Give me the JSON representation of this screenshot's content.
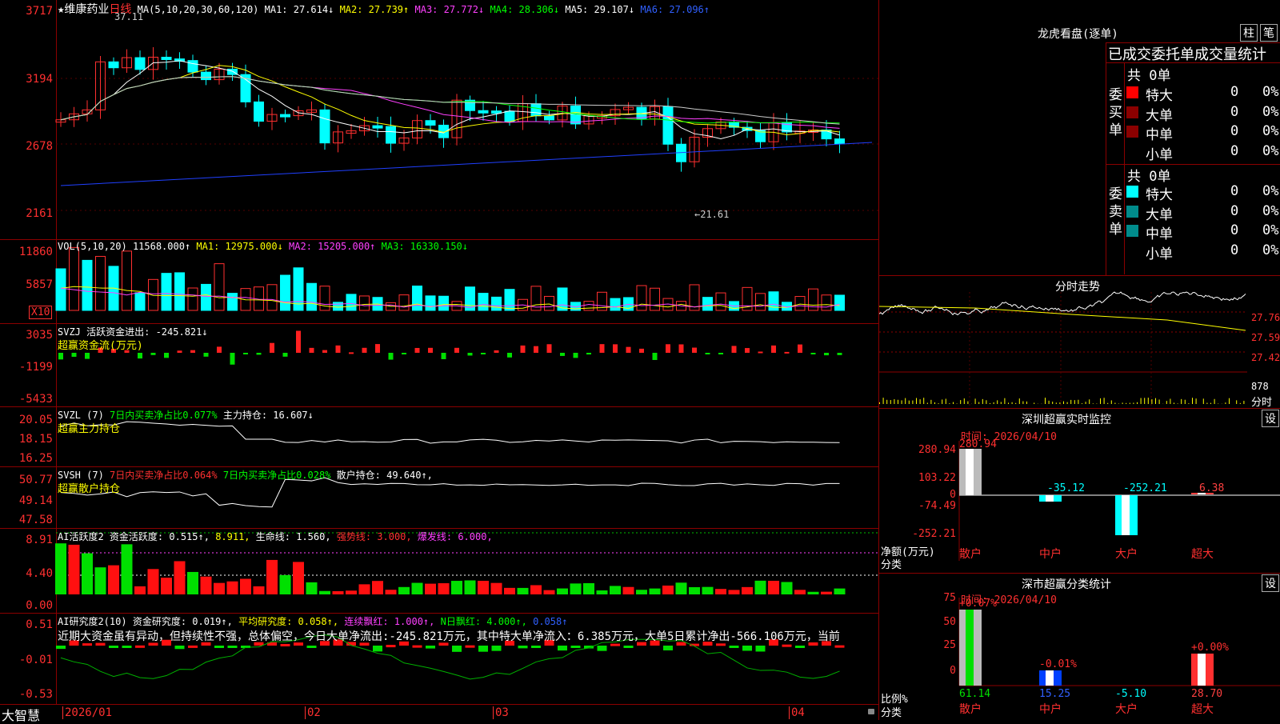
{
  "stock": {
    "name": "★维康药业",
    "period": "日线"
  },
  "price_header": {
    "ma_params": "MA(5,10,20,30,60,120)",
    "ma1": "MA1: 27.614↓",
    "ma2": "MA2: 27.739↑",
    "ma3": "MA3: 27.772↓",
    "ma4": "MA4: 28.306↓",
    "ma5": "MA5: 29.107↓",
    "ma6": "MA6: 27.096↑"
  },
  "price_axis": [
    "3717",
    "3194",
    "2678",
    "2161"
  ],
  "price_marks": {
    "high": "37.11",
    "low": "←21.61"
  },
  "vol_header": {
    "name": "VOL(5,10,20)",
    "val": "11568.000↑",
    "ma1": "MA1: 12975.000↓",
    "ma2": "MA2: 15205.000↑",
    "ma3": "MA3: 16330.150↓"
  },
  "vol_axis": [
    "11860",
    "5857"
  ],
  "vol_unit": "X10",
  "svzj": {
    "header": "SVZJ  活跃资金进出: -245.821↓",
    "sub": "超赢资金流(万元)",
    "axis": [
      "3035",
      "-1199",
      "-5433"
    ]
  },
  "svzl": {
    "name": "SVZL (7)",
    "ratio": "7日内买卖净占比0.077%",
    "hold": "主力持仓: 16.607↓",
    "sub": "超赢主力持仓",
    "axis": [
      "20.05",
      "18.15",
      "16.25"
    ]
  },
  "svsh": {
    "name": "SVSH (7)",
    "ratio1": "7日内买卖净占比0.064%",
    "ratio2": "7日内买卖净占比0.028%",
    "hold": "散户持仓: 49.640↑,",
    "sub": "超赢散户持仓",
    "axis": [
      "50.77",
      "49.14",
      "47.58"
    ]
  },
  "ai1": {
    "name": "AI活跃度2",
    "a": "资金活跃度: 0.515↑,",
    "b": "8.911,",
    "c": "生命线: 1.560,",
    "d": "强势线: 3.000,",
    "e": "爆发线: 6.000,",
    "axis": [
      "8.91",
      "4.40",
      "0.00"
    ]
  },
  "ai2": {
    "name": "AI研究度2(10)",
    "a": "资金研究度: 0.019↑,",
    "b": "平均研究度: 0.058↑,",
    "c": "连续飘红: 1.000↑,",
    "d": "N日飘红: 4.000↑,",
    "e": "0.058↑",
    "axis": [
      "0.51",
      "-0.01",
      "-0.53"
    ],
    "comment": "近期大资金虽有异动，但持续性不强，总体偏空，今日大单净流出:-245.821万元，其中特大单净流入：6.385万元，大单5日累计净出-566.106万元，当前"
  },
  "date_axis": {
    "brand": "大智慧",
    "labels": [
      "2026/01",
      "02",
      "03",
      "04"
    ]
  },
  "lhb": {
    "title": "龙虎看盘(逐单)",
    "btn1": "柱",
    "btn2": "笔",
    "sub": "已成交委托单成交量统计",
    "buy_label": "委买单",
    "sell_label": "委卖单",
    "buy_total": "共 0单",
    "sell_total": "共 0单",
    "buy_rows": [
      {
        "name": "特大",
        "num": "0",
        "pct": "0%",
        "color": "#ff0000"
      },
      {
        "name": "大单",
        "num": "0",
        "pct": "0%",
        "color": "#8b0000"
      },
      {
        "name": "中单",
        "num": "0",
        "pct": "0%",
        "color": "#8b0000"
      },
      {
        "name": "小单",
        "num": "0",
        "pct": "0%",
        "color": "#000000"
      }
    ],
    "sell_rows": [
      {
        "name": "特大",
        "num": "0",
        "pct": "0%",
        "color": "#00ffff"
      },
      {
        "name": "大单",
        "num": "0",
        "pct": "0%",
        "color": "#008b8b"
      },
      {
        "name": "中单",
        "num": "0",
        "pct": "0%",
        "color": "#008b8b"
      },
      {
        "name": "小单",
        "num": "0",
        "pct": "0%",
        "color": "#000000"
      }
    ]
  },
  "fenshi": {
    "title": "分时走势",
    "axis": [
      "27.76",
      "27.59",
      "27.42"
    ],
    "vol": "878",
    "vol_label": "分时"
  },
  "monitor": {
    "title": "深圳超赢实时监控",
    "btn": "设",
    "time": "时间: 2026/04/10",
    "axis": [
      "280.94",
      "103.22",
      "0",
      "-74.49",
      "-252.21"
    ],
    "unit1": "净额(万元)",
    "unit2": "分类",
    "bars": [
      {
        "label": "散户",
        "value": "280.94"
      },
      {
        "label": "中户",
        "value": "-35.12"
      },
      {
        "label": "大户",
        "value": "-252.21"
      },
      {
        "label": "超大",
        "value": "6.38"
      }
    ]
  },
  "classify": {
    "title": "深市超赢分类统计",
    "btn": "设",
    "time": "时间: 2026/04/10",
    "axis": [
      "75",
      "50",
      "25",
      "0"
    ],
    "unit1": "比例%",
    "unit2": "分类",
    "bars": [
      {
        "label": "散户",
        "pct": "+0.07%",
        "val": "61.14"
      },
      {
        "label": "中户",
        "pct": "-0.01%",
        "val": "15.25"
      },
      {
        "label": "大户",
        "pct": "",
        "val": "-5.10"
      },
      {
        "label": "超大",
        "pct": "+0.00%",
        "val": "28.70"
      }
    ]
  }
}
